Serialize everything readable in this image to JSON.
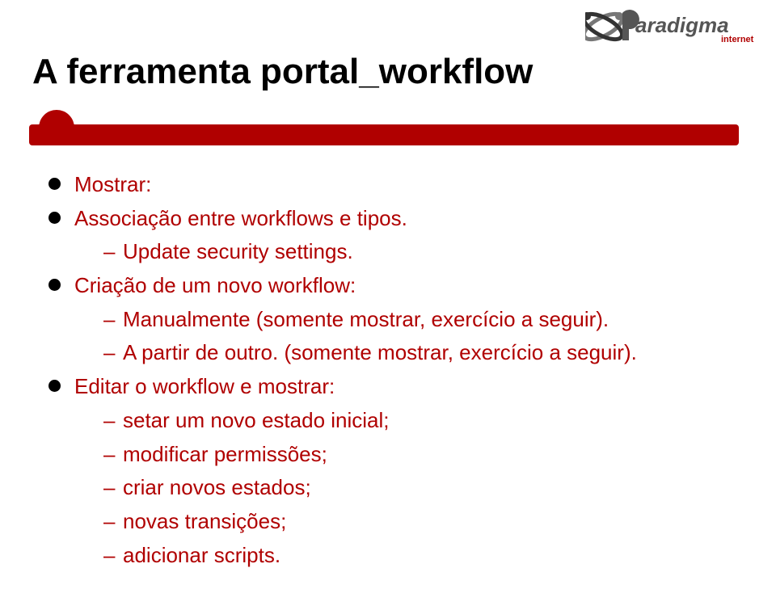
{
  "logo": {
    "brand_text": "aradigma",
    "sub_text": "internet"
  },
  "title": "A ferramenta portal_workflow",
  "bullets": [
    {
      "text": "Mostrar:",
      "children": []
    },
    {
      "text": "Associação entre workflows e tipos.",
      "children": [
        {
          "text": "Update security settings."
        }
      ]
    },
    {
      "text": "Criação de um novo workflow:",
      "children": [
        {
          "text": "Manualmente (somente mostrar, exercício a seguir)."
        },
        {
          "text": "A partir de outro. (somente mostrar, exercício a seguir)."
        }
      ]
    },
    {
      "text": "Editar o workflow e mostrar:",
      "children": [
        {
          "text": "setar um novo estado inicial;"
        },
        {
          "text": "modificar permissões;"
        },
        {
          "text": "criar novos estados;"
        },
        {
          "text": "novas transições;"
        },
        {
          "text": "adicionar scripts."
        }
      ]
    }
  ]
}
